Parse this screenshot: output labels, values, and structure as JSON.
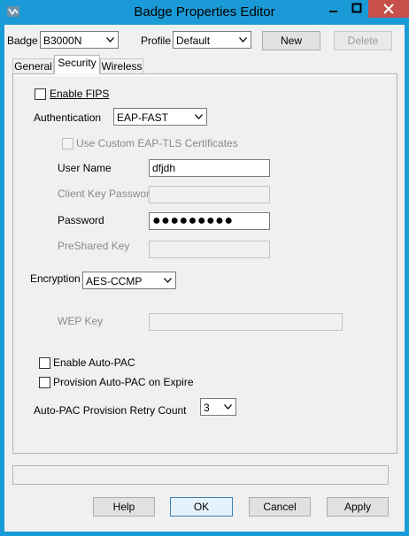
{
  "window": {
    "title": "Badge Properties Editor"
  },
  "top": {
    "badge_label": "Badge",
    "badge_value": "B3000N",
    "profile_label": "Profile",
    "profile_value": "Default",
    "new_label": "New",
    "delete_label": "Delete"
  },
  "tabs": [
    {
      "label": "General",
      "active": false
    },
    {
      "label": "Security",
      "active": true
    },
    {
      "label": "Wireless",
      "active": false
    }
  ],
  "security": {
    "enable_fips_label": "Enable FIPS",
    "enable_fips_checked": false,
    "authentication_label": "Authentication",
    "authentication_value": "EAP-FAST",
    "custom_eap_tls_label": "Use Custom EAP-TLS Certificates",
    "user_name_label": "User Name",
    "user_name_value": "dfjdh",
    "client_key_password_label": "Client Key Password",
    "password_label": "Password",
    "password_value": "●●●●●●●●●",
    "preshared_key_label": "PreShared Key",
    "encryption_label": "Encryption",
    "encryption_value": "AES-CCMP",
    "wep_key_label": "WEP Key",
    "enable_auto_pac_label": "Enable Auto-PAC",
    "provision_auto_pac_label": "Provision Auto-PAC on Expire",
    "retry_count_label": "Auto-PAC Provision Retry Count",
    "retry_count_value": "3"
  },
  "footer": {
    "help_label": "Help",
    "ok_label": "OK",
    "cancel_label": "Cancel",
    "apply_label": "Apply"
  },
  "colors": {
    "titlebar": "#1a9bd7",
    "close_button": "#c7504a",
    "dialog_bg": "#f0f0f0"
  }
}
